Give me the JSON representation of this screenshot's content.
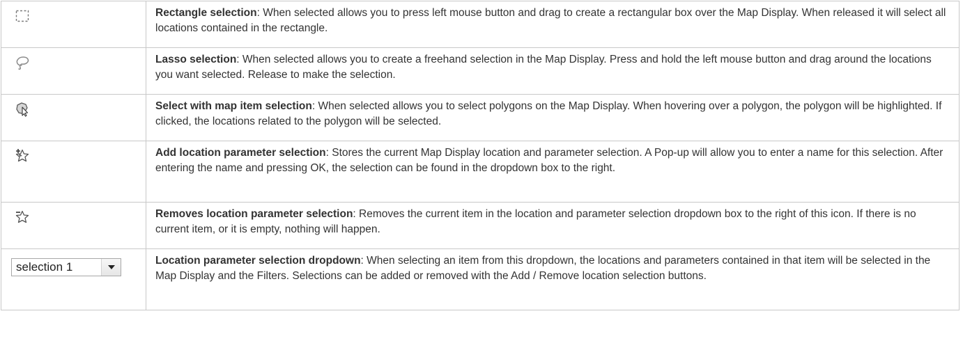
{
  "rows": [
    {
      "icon": "rectangle-selection-icon",
      "title": "Rectangle selection",
      "desc": ": When selected allows you to press left mouse button and drag to create a rectangular box over the Map Display. When released it will select all locations contained in the rectangle."
    },
    {
      "icon": "lasso-selection-icon",
      "title": "Lasso selection",
      "desc": ": When selected allows you to create a freehand selection in the Map Display. Press and hold the left mouse button and drag around the locations you want selected. Release to make the selection."
    },
    {
      "icon": "map-item-selection-icon",
      "title": "Select with map item selection",
      "desc": ": When selected allows you to select polygons on the Map Display. When hovering over a polygon, the polygon will be highlighted. If clicked, the locations related to the polygon will be selected."
    },
    {
      "icon": "add-star-icon",
      "title": "Add location parameter selection",
      "desc": ": Stores the current Map Display location and parameter selection. A Pop-up will allow you to enter a name for this selection. After entering the name and pressing OK, the selection can be found in the dropdown box to the right."
    },
    {
      "icon": "remove-star-icon",
      "title": "Removes location parameter selection",
      "desc": ": Removes the current item in the location and parameter selection dropdown box to the right of this icon. If there is no current item, or it is empty, nothing will happen."
    },
    {
      "icon": "dropdown-control",
      "title": "Location parameter selection dropdown",
      "desc": ": When selecting an item from this dropdown, the locations and parameters contained in that item will be selected in the Map Display and the Filters. Selections can be added or removed with the Add / Remove location selection buttons."
    }
  ],
  "dropdown": {
    "selected_value": "selection 1"
  }
}
